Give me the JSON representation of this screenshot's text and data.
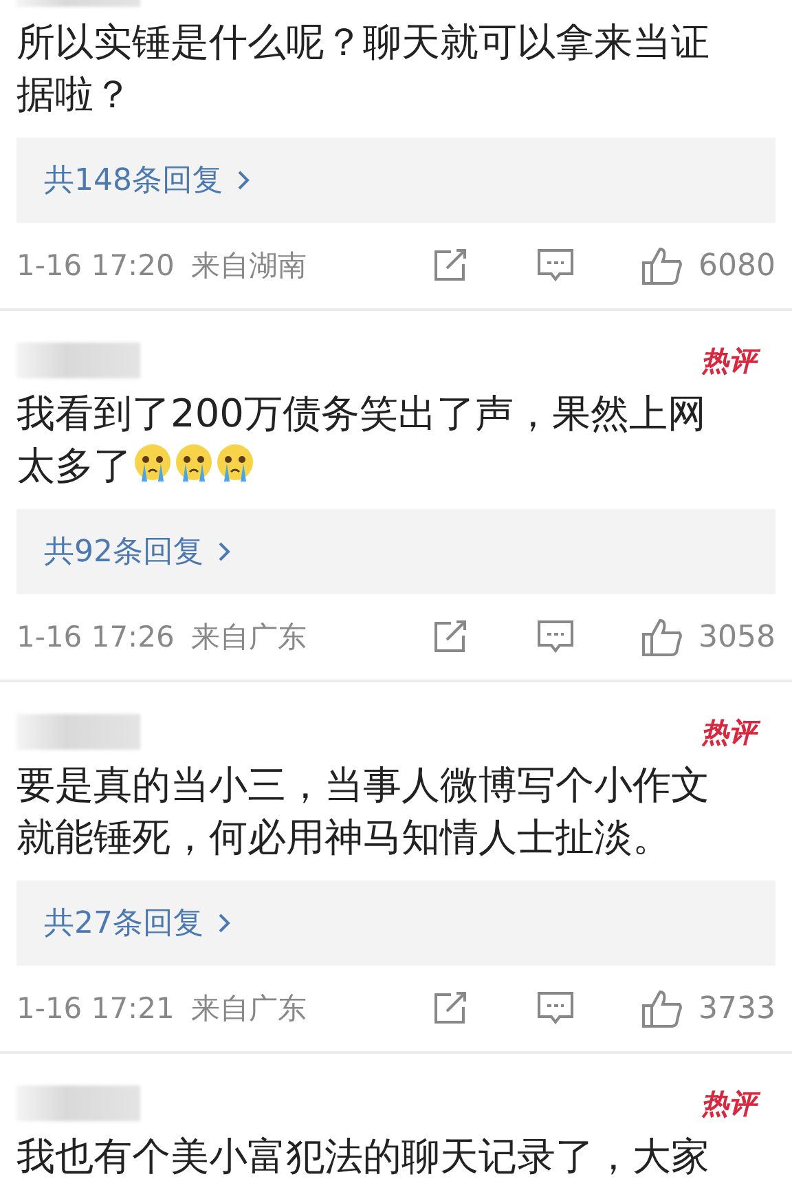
{
  "comments": [
    {
      "text": "所以实锤是什么呢？聊天就可以拿来当证据啦？",
      "replies": "共148条回复",
      "time": "1-16 17:20",
      "location": "来自湖南",
      "likes": "6080"
    },
    {
      "badge": "热评",
      "text": "我看到了200万债务笑出了声，果然上网太多了",
      "emojis": [
        {
          "kind": "crying"
        },
        {
          "kind": "crying"
        },
        {
          "kind": "crying"
        }
      ],
      "replies": "共92条回复",
      "time": "1-16 17:26",
      "location": "来自广东",
      "likes": "3058"
    },
    {
      "badge": "热评",
      "text": "要是真的当小三，当事人微博写个小作文就能锤死，何必用神马知情人士扯淡。",
      "replies": "共27条回复",
      "time": "1-16 17:21",
      "location": "来自广东",
      "likes": "3733"
    },
    {
      "badge": "热评",
      "text": "我也有个美小富犯法的聊天记录了，大家"
    }
  ]
}
